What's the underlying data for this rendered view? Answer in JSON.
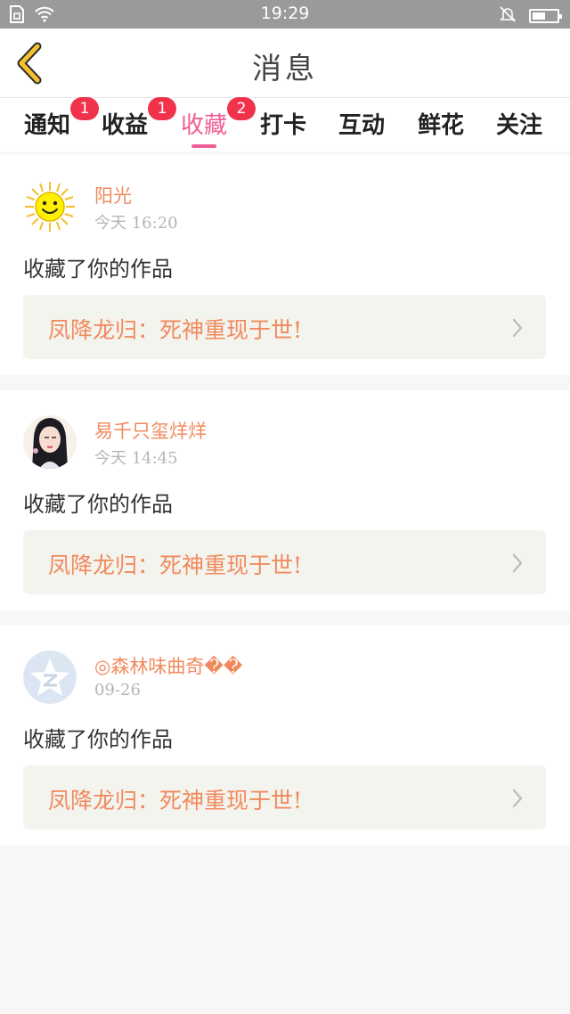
{
  "status": {
    "time": "19:29"
  },
  "header": {
    "title": "消息"
  },
  "tabs": [
    {
      "label": "通知",
      "badge": "1",
      "active": false
    },
    {
      "label": "收益",
      "badge": "1",
      "active": false
    },
    {
      "label": "收藏",
      "badge": "2",
      "active": true
    },
    {
      "label": "打卡",
      "badge": "",
      "active": false
    },
    {
      "label": "互动",
      "badge": "",
      "active": false
    },
    {
      "label": "鲜花",
      "badge": "",
      "active": false
    },
    {
      "label": "关注",
      "badge": "",
      "active": false
    }
  ],
  "messages": [
    {
      "name": "阳光",
      "time": "今天 16:20",
      "action": "收藏了你的作品",
      "work": "凤降龙归：死神重现于世!",
      "avatar_icon": "sun-icon"
    },
    {
      "name": "易千只玺烊烊",
      "time": "今天 14:45",
      "action": "收藏了你的作品",
      "work": "凤降龙归：死神重现于世!",
      "avatar_icon": "girl-portrait"
    },
    {
      "name": "◎森林味曲奇��",
      "time": "09-26",
      "action": "收藏了你的作品",
      "work": "凤降龙归：死神重现于世!",
      "avatar_icon": "qzone-star-icon"
    }
  ],
  "colors": {
    "accent": "#ee5d93",
    "badge": "#f0334b",
    "name": "#f08a5d",
    "back_arrow": "#f3c12f"
  }
}
